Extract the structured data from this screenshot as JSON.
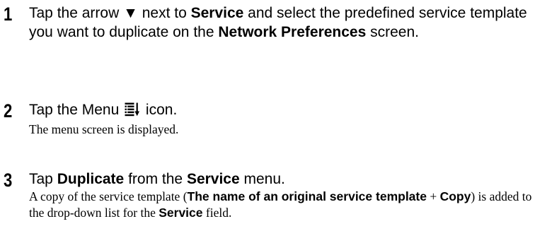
{
  "steps": [
    {
      "number": "1",
      "instruction": {
        "t1": "Tap the arrow ",
        "arrow": "▼",
        "t2": " next to ",
        "b1": "Service",
        "t3": " and select the predefined service template you want to duplicate on the ",
        "b2": "Network Preferences",
        "t4": " screen."
      }
    },
    {
      "number": "2",
      "instruction": {
        "t1": "Tap the Menu ",
        "icon": "menu-icon",
        "t2": " icon."
      },
      "note": "The menu screen is displayed."
    },
    {
      "number": "3",
      "instruction": {
        "t1": "Tap ",
        "b1": "Duplicate",
        "t2": " from the ",
        "b2": "Service",
        "t3": " menu."
      },
      "note": {
        "t1": "A copy of the service template (",
        "b1": "The name of an original service template",
        "t2": " + ",
        "b2": "Copy",
        "t3": ") is added to the drop-down list for the ",
        "b3": "Service",
        "t4": " field."
      }
    }
  ]
}
